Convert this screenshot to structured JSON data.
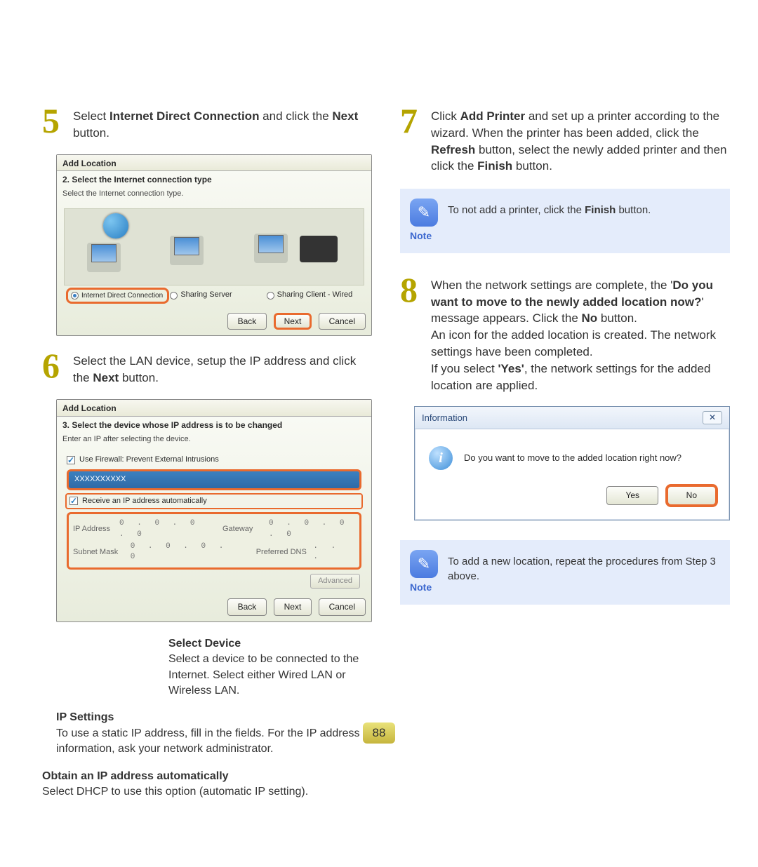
{
  "pageNumber": "88",
  "left": {
    "step5": {
      "num": "5",
      "textParts": [
        "Select ",
        "Internet Direct Connection",
        " and click the ",
        "Next",
        " button."
      ]
    },
    "shot5": {
      "title": "Add Location",
      "subtitle": "2. Select the Internet connection type",
      "hint": "Select the Internet connection type.",
      "opt1": "Internet Direct Connection",
      "opt2": "Sharing Server",
      "opt3": "Sharing Client - Wired",
      "back": "Back",
      "next": "Next",
      "cancel": "Cancel"
    },
    "step6": {
      "num": "6",
      "textParts": [
        "Select the LAN device, setup the IP address and click the ",
        "Next",
        " button."
      ]
    },
    "shot6": {
      "title": "Add Location",
      "subtitle": "3. Select the device whose IP address is to be changed",
      "hint": "Enter an IP after selecting the device.",
      "fw": "Use Firewall: Prevent External Intrusions",
      "device": "XXXXXXXXXX",
      "auto": "Receive an IP address automatically",
      "ip_lbl": "IP Address",
      "ip_val": "0 . 0 . 0 . 0",
      "gw_lbl": "Gateway",
      "gw_val": "0 . 0 . 0 . 0",
      "sm_lbl": "Subnet Mask",
      "sm_val": "0 . 0 . 0 . 0",
      "dns_lbl": "Preferred DNS",
      "dns_val": ". . .",
      "adv": "Advanced",
      "back": "Back",
      "next": "Next",
      "cancel": "Cancel"
    },
    "callouts": {
      "selDev_title": "Select Device",
      "selDev_text": "Select a device to be connected to the Internet. Select either Wired LAN or Wireless LAN.",
      "ipSet_title": "IP Settings",
      "ipSet_text": "To use a static IP address, fill in the fields. For the IP address information, ask your network administrator.",
      "obtain_title": "Obtain an IP address automatically",
      "obtain_text": "Select DHCP to use this option (automatic IP setting)."
    }
  },
  "right": {
    "step7": {
      "num": "7",
      "textParts": [
        "Click ",
        "Add Printer",
        " and set up a printer according to the wizard. When the printer has been added, click the ",
        "Refresh",
        " button, select the newly added printer and then click the ",
        "Finish",
        " button."
      ]
    },
    "note1": {
      "label": "Note",
      "textParts": [
        "To not add a printer, click the ",
        "Finish",
        " button."
      ]
    },
    "step8": {
      "num": "8",
      "textParts": [
        "When the network settings are complete, the '",
        "Do you want to move to the newly added location now?",
        "' message appears. Click the ",
        "No",
        " button."
      ],
      "extra1": "An icon for the added location is created. The network settings have been completed.",
      "extra2Parts": [
        "If you select ",
        "'Yes'",
        ", the network settings for the added location are applied."
      ]
    },
    "dialog": {
      "title": "Information",
      "msg": "Do you want to move to the added location right now?",
      "yes": "Yes",
      "no": "No"
    },
    "note2": {
      "label": "Note",
      "text": "To add a new location, repeat the procedures from Step 3 above."
    }
  }
}
